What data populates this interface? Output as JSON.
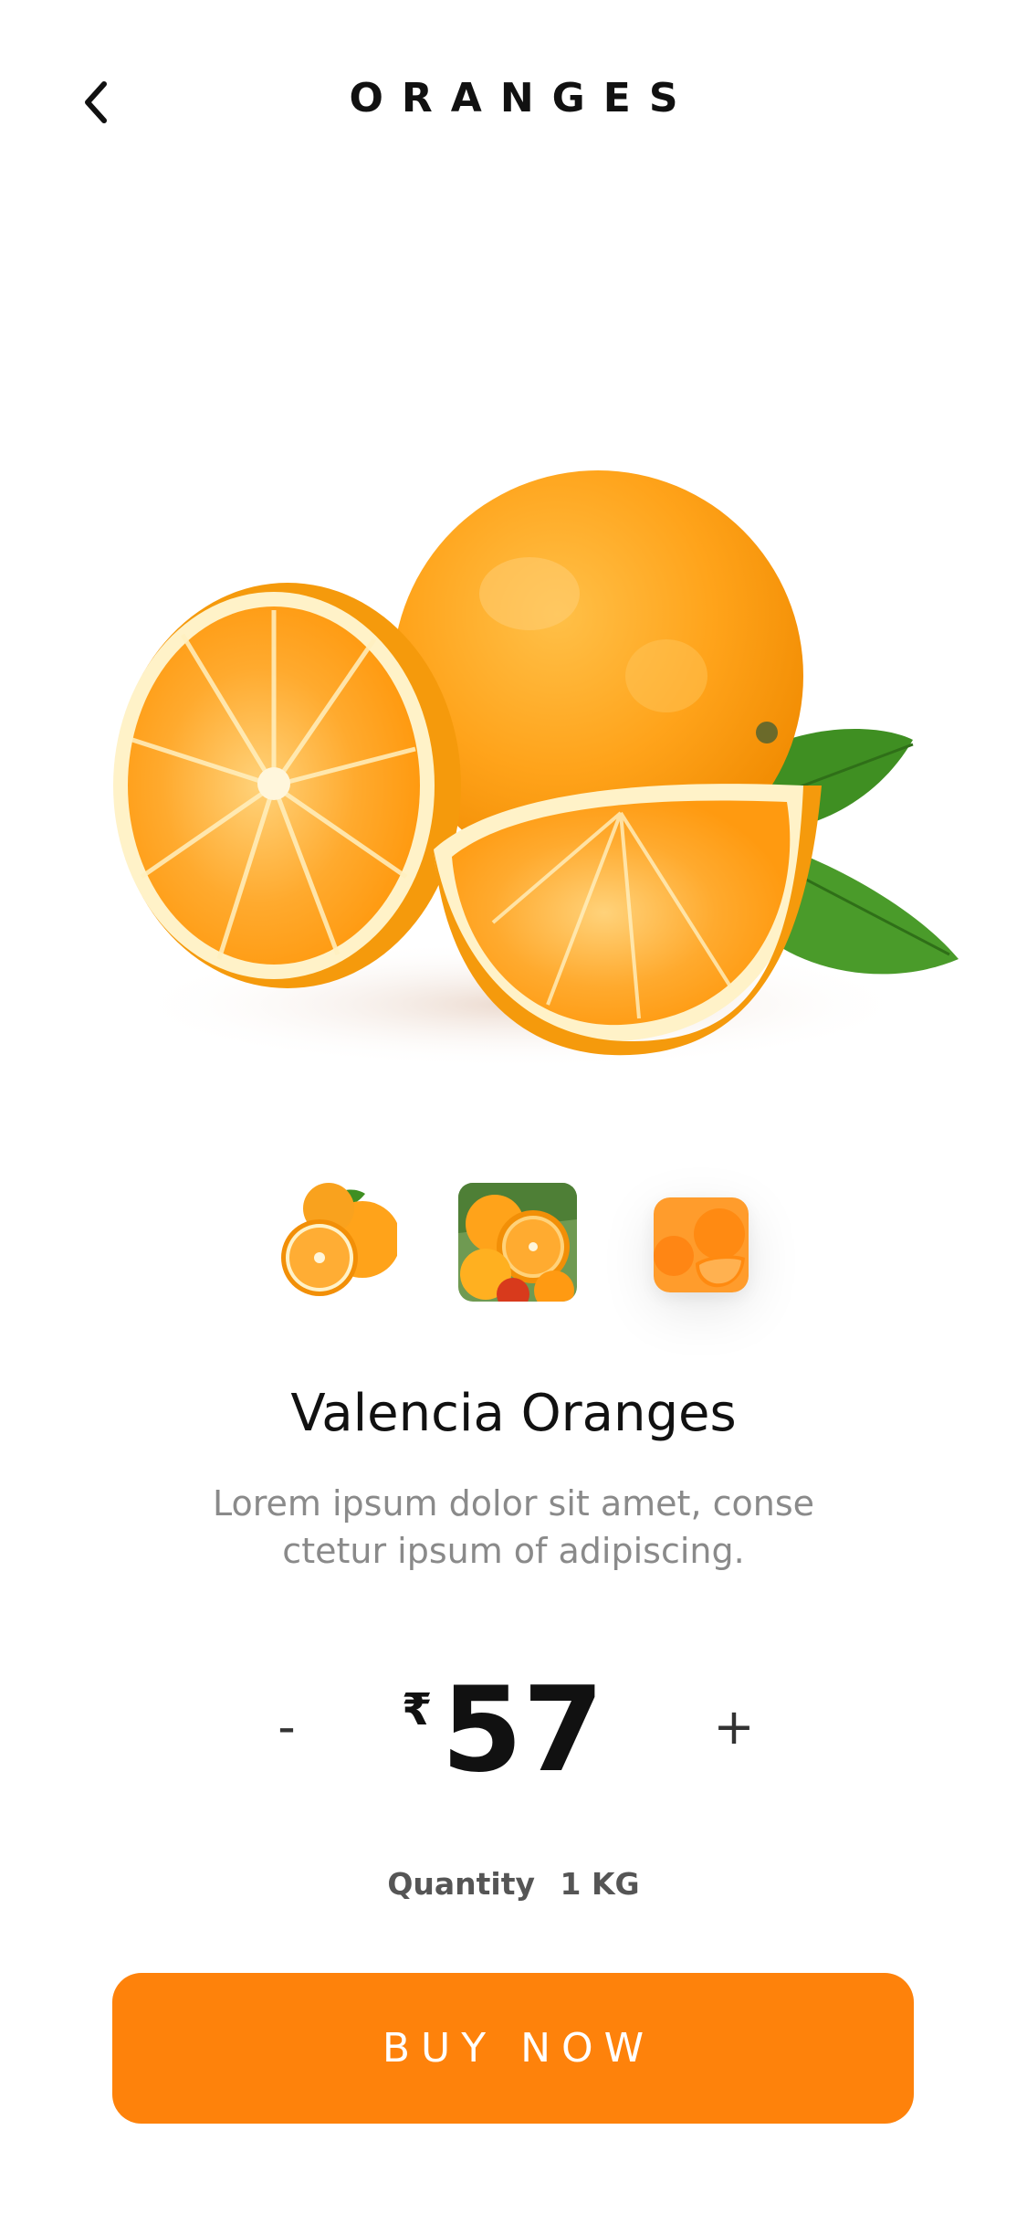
{
  "header": {
    "title": "ORANGES"
  },
  "product": {
    "name": "Valencia Oranges",
    "description": "Lorem ipsum dolor sit amet, conse ctetur ipsum of adipiscing."
  },
  "price": {
    "currency_symbol": "₹",
    "amount": "57",
    "decrement_label": "-",
    "increment_label": "+"
  },
  "quantity": {
    "label": "Quantity",
    "value": "1 KG"
  },
  "cta": {
    "label": "BUY NOW"
  },
  "thumbnails": [
    {
      "name": "orange-halves-thumbnail"
    },
    {
      "name": "orange-bowl-thumbnail"
    },
    {
      "name": "orange-slices-thumbnail",
      "selected": true
    }
  ],
  "colors": {
    "accent": "#fe820b",
    "orange": "#ffa31a",
    "leaf": "#3f8f22",
    "text": "#111111",
    "muted": "#8a8a8a"
  }
}
